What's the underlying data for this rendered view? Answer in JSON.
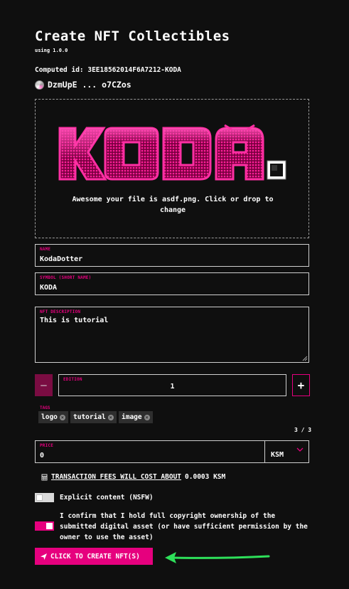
{
  "page": {
    "title": "Create NFT Collectibles",
    "version": "using 1.0.0",
    "computed_id": "Computed id: 3EE18562014F6A7212-KODA",
    "owner": "DzmUpE ... o7CZos"
  },
  "dropzone": {
    "text": "Awesome your file is asdf.png. Click or drop to change",
    "image_alt": "KODA"
  },
  "fields": {
    "name_label": "NAME",
    "name_value": "KodaDotter",
    "symbol_label": "SYMBOL (SHORT NAME)",
    "symbol_value": "KODA",
    "description_label": "NFT DESCRIPTION",
    "description_value": "This is tutorial",
    "edition_label": "EDITION",
    "edition_value": "1",
    "minus_label": "–",
    "plus_label": "+",
    "tags_label": "TAGS",
    "tags": [
      "logo",
      "tutorial",
      "image"
    ],
    "tag_count": "3 / 3",
    "price_label": "PRICE",
    "price_value": "0",
    "currency": "KSM"
  },
  "fees": {
    "link_text": "TRANSACTION FEES WILL COST ABOUT",
    "amount": "0.0003 KSM",
    "icon": "calculator-icon"
  },
  "toggles": {
    "nsfw_label": "Explicit content (NSFW)",
    "nsfw_on": false,
    "confirm_label": "I confirm that I hold full copyright ownership of the submitted digital asset (or have sufficient permission by the owner to use the asset)",
    "confirm_on": true
  },
  "submit": {
    "label": "CLICK TO CREATE NFT(S)",
    "icon": "send-icon"
  },
  "colors": {
    "accent": "#e6007e",
    "background": "#0f0f0f",
    "arrow": "#2ee05a"
  }
}
